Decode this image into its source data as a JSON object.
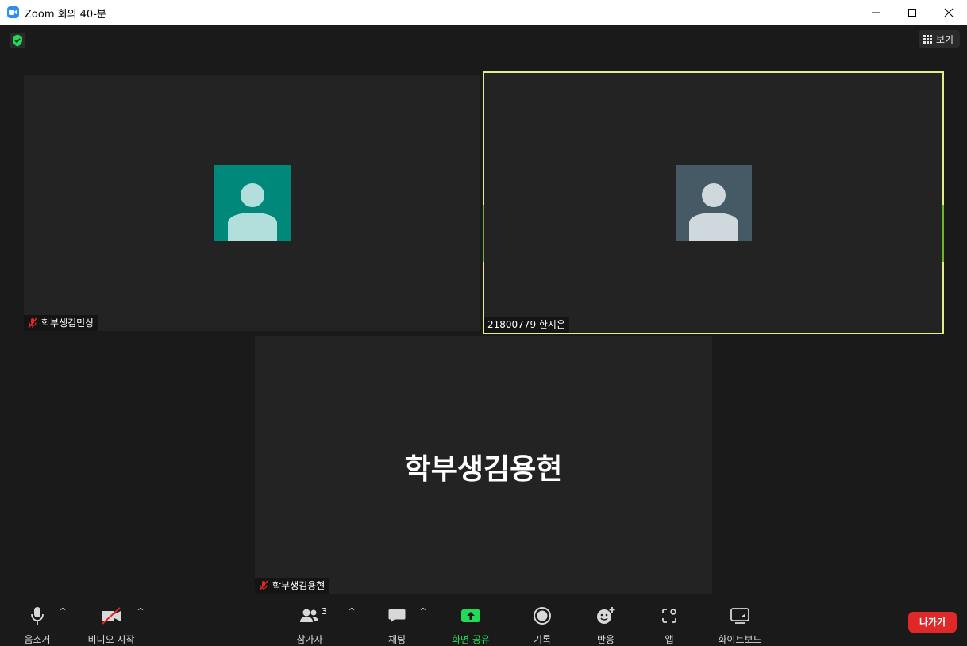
{
  "window": {
    "title": "Zoom 회의 40-분",
    "controls": [
      "minimize-icon",
      "maximize-icon",
      "close-icon"
    ]
  },
  "top_controls": {
    "security_icon": "shield-check-icon",
    "view_label": "보기"
  },
  "participants": [
    {
      "name": "학부생김민상",
      "muted": true,
      "avatar_color": "#00897B"
    },
    {
      "name": "21800779 한시온",
      "muted": false,
      "active_speaker": true,
      "avatar_color": "#455A64"
    },
    {
      "name": "학부생김용현",
      "muted": true,
      "display_name_big": "학부생김용현"
    }
  ],
  "toolbar": {
    "mute_label": "음소거",
    "video_label": "비디오 시작",
    "participants_label": "참가자",
    "participants_count": "3",
    "chat_label": "채팅",
    "share_label": "화면 공유",
    "record_label": "기록",
    "reactions_label": "반응",
    "apps_label": "앱",
    "whiteboard_label": "화이트보드",
    "leave_label": "나가기"
  },
  "colors": {
    "accent_share": "#23D959",
    "active_speaker_border": "#E1EF8B",
    "leave": "#E02828",
    "zoom_blue": "#2D8CFF"
  }
}
